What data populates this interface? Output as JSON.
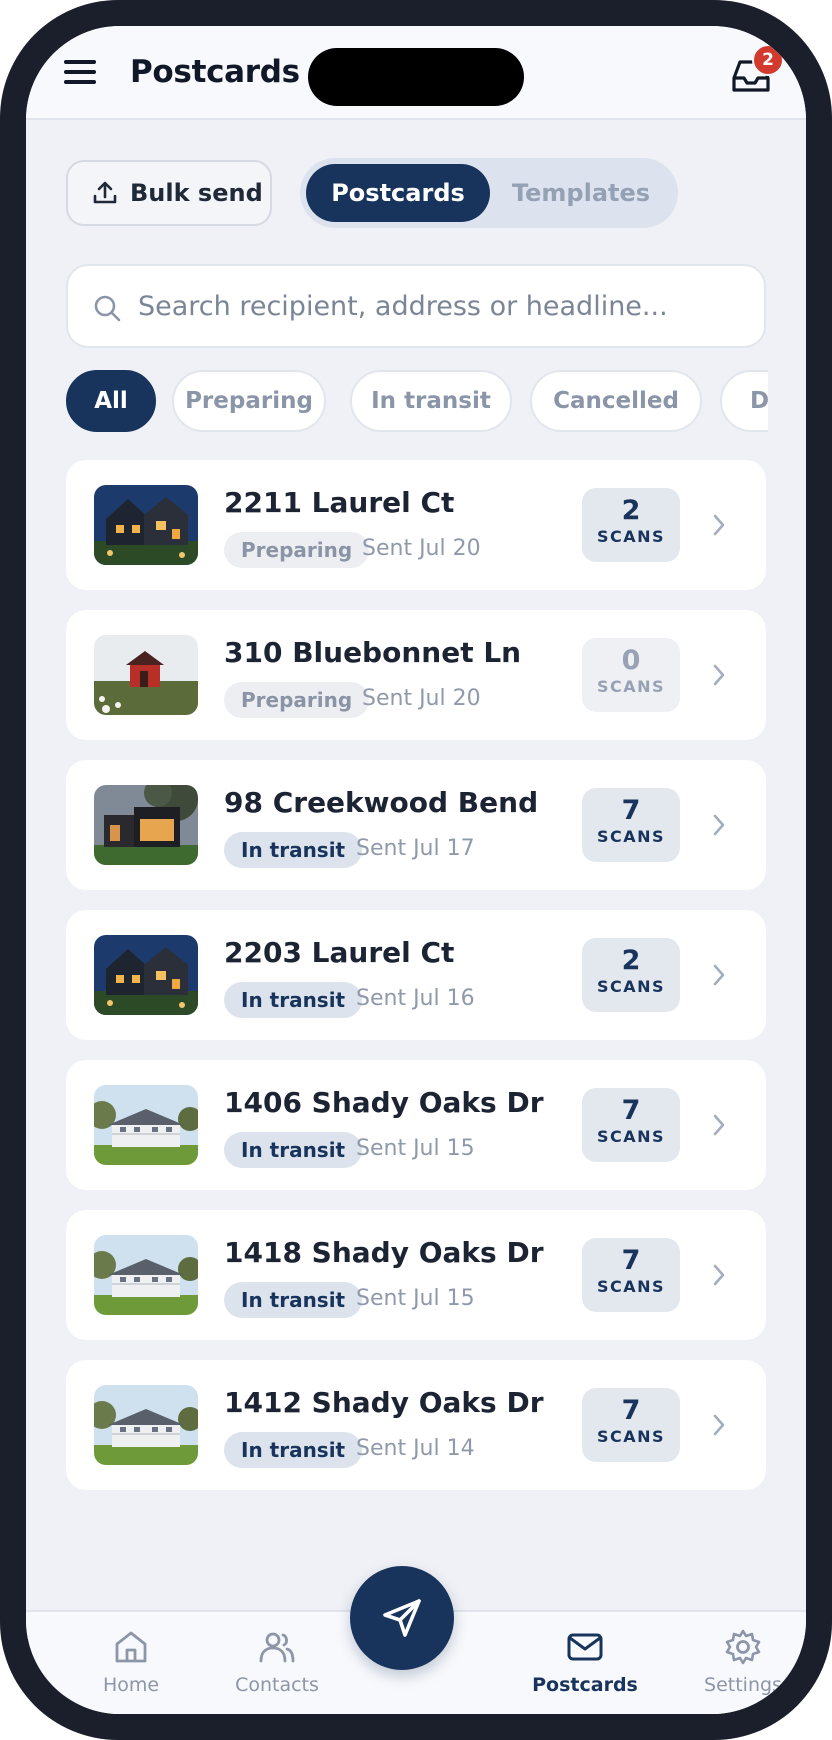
{
  "header": {
    "title": "Postcards",
    "notification_count": "2"
  },
  "toolbar": {
    "bulk_send_label": "Bulk send",
    "segments": [
      {
        "label": "Postcards",
        "active": true
      },
      {
        "label": "Templates",
        "active": false
      }
    ]
  },
  "search": {
    "placeholder": "Search recipient, address or headline...",
    "value": ""
  },
  "filters": [
    {
      "label": "All",
      "active": true
    },
    {
      "label": "Preparing",
      "active": false
    },
    {
      "label": "In transit",
      "active": false
    },
    {
      "label": "Cancelled",
      "active": false
    },
    {
      "label": "Delivered",
      "active": false
    }
  ],
  "postcards": [
    {
      "address": "2211 Laurel Ct",
      "status": "Preparing",
      "sent": "Sent Jul 20",
      "scans": "2",
      "scans_label": "SCANS",
      "thumbnail": "dusk-house"
    },
    {
      "address": "310 Bluebonnet Ln",
      "status": "Preparing",
      "sent": "Sent Jul 20",
      "scans": "0",
      "scans_label": "SCANS",
      "thumbnail": "red-cabin"
    },
    {
      "address": "98 Creekwood Bend",
      "status": "In transit",
      "sent": "Sent Jul 17",
      "scans": "7",
      "scans_label": "SCANS",
      "thumbnail": "modern-house"
    },
    {
      "address": "2203 Laurel Ct",
      "status": "In transit",
      "sent": "Sent Jul 16",
      "scans": "2",
      "scans_label": "SCANS",
      "thumbnail": "dusk-house"
    },
    {
      "address": "1406 Shady Oaks Dr",
      "status": "In transit",
      "sent": "Sent Jul 15",
      "scans": "7",
      "scans_label": "SCANS",
      "thumbnail": "white-colonial"
    },
    {
      "address": "1418 Shady Oaks Dr",
      "status": "In transit",
      "sent": "Sent Jul 15",
      "scans": "7",
      "scans_label": "SCANS",
      "thumbnail": "white-colonial"
    },
    {
      "address": "1412 Shady Oaks Dr",
      "status": "In transit",
      "sent": "Sent Jul 14",
      "scans": "7",
      "scans_label": "SCANS",
      "thumbnail": "white-colonial"
    }
  ],
  "nav": {
    "tabs": [
      {
        "label": "Home",
        "icon": "home-icon",
        "active": false
      },
      {
        "label": "Contacts",
        "icon": "contacts-icon",
        "active": false
      },
      {
        "label": "Postcards",
        "icon": "mail-icon",
        "active": true
      },
      {
        "label": "Settings",
        "icon": "gear-icon",
        "active": false
      }
    ],
    "fab_icon": "send-icon"
  },
  "colors": {
    "primary": "#18345c",
    "background": "#eff1f6",
    "badge": "#d23a2e"
  }
}
